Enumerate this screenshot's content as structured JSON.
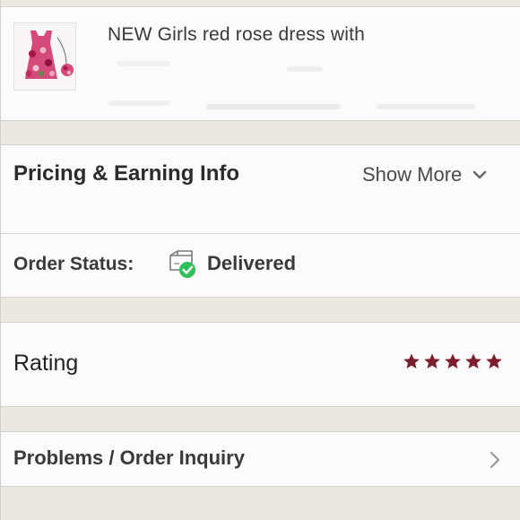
{
  "product": {
    "title": "NEW Girls red rose dress with",
    "thumbnail_icon": "product-photo-dress"
  },
  "pricing": {
    "label": "Pricing & Earning Info",
    "show_more_label": "Show More",
    "show_more_icon": "chevron-down-icon"
  },
  "order_status": {
    "label": "Order Status:",
    "value": "Delivered",
    "icon": "delivered-box-check-icon",
    "icon_color": "#2fbf5b"
  },
  "rating": {
    "label": "Rating",
    "stars": 5,
    "max_stars": 5,
    "star_color": "#7b1f2c"
  },
  "problems": {
    "label": "Problems / Order Inquiry",
    "icon": "chevron-right-icon"
  },
  "colors": {
    "background": "#ebe8e2",
    "card": "#fbfbfb",
    "text": "#2b2b2b"
  }
}
